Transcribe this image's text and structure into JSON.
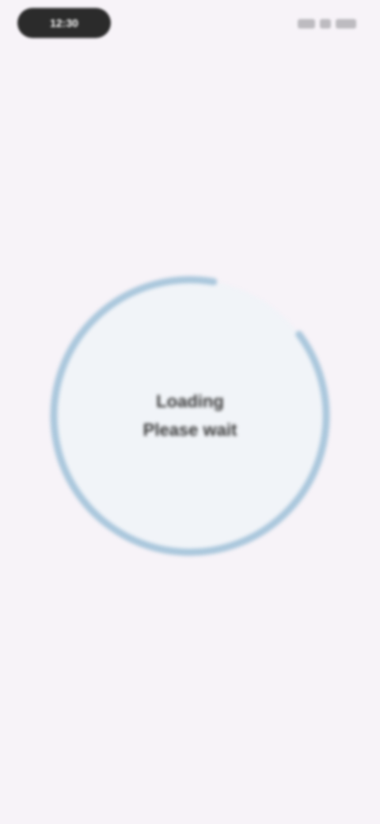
{
  "status_bar": {
    "time": "12:30",
    "icons": [
      "signal-icon",
      "wifi-icon",
      "battery-icon"
    ]
  },
  "loader": {
    "line1": "Loading",
    "line2": "Please wait",
    "progress": 0.88,
    "track_color": "#c9dfec",
    "arc_color": "#aac7dc"
  }
}
